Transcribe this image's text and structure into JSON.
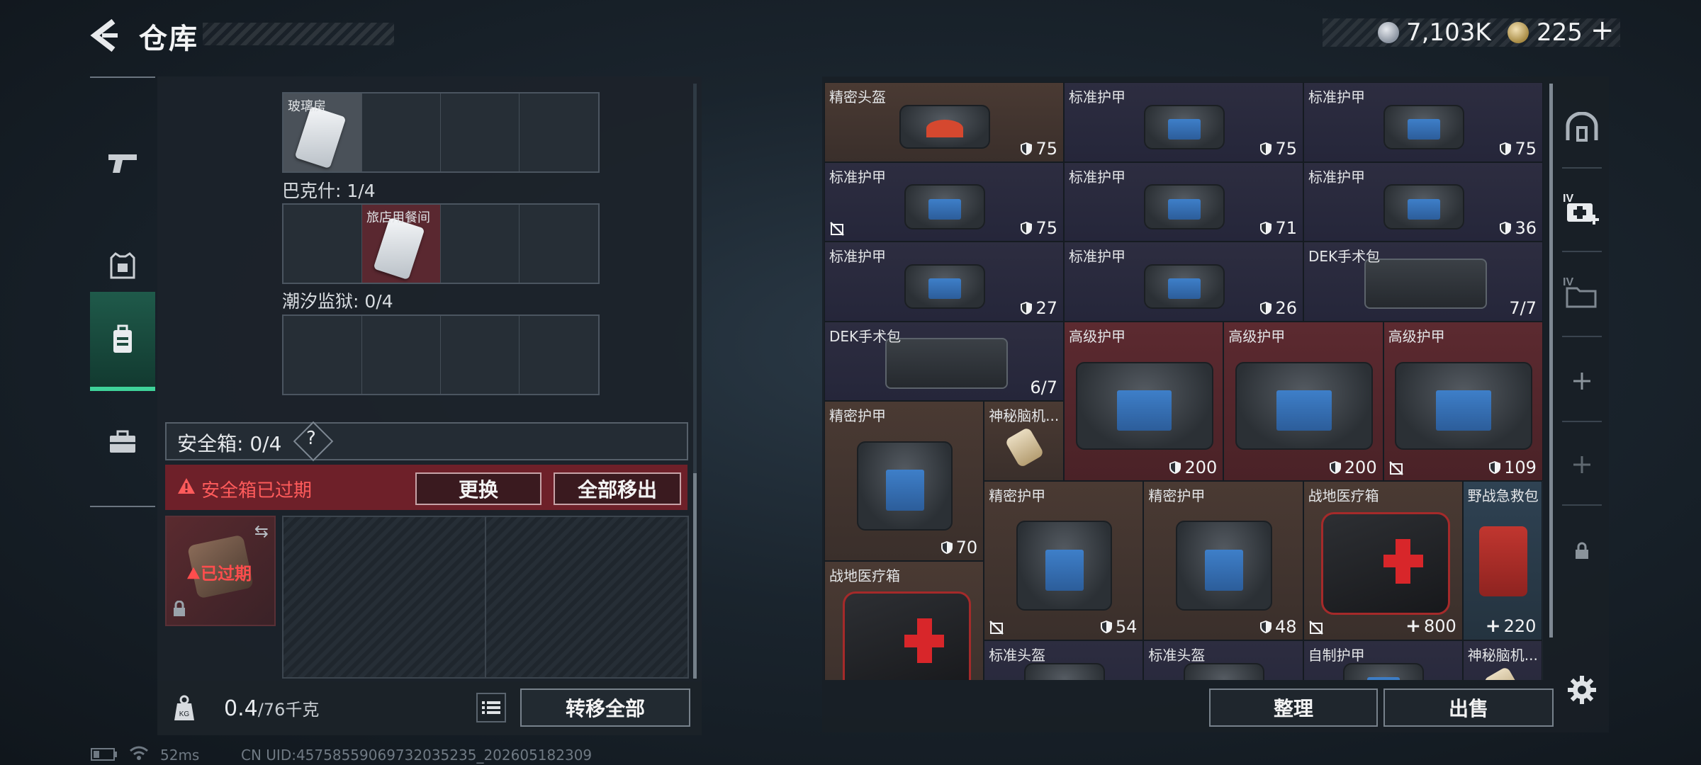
{
  "header": {
    "title": "仓库",
    "currency": [
      {
        "icon": "silver-coin-icon",
        "value": "7,103K"
      },
      {
        "icon": "gold-coin-icon",
        "value": "225"
      }
    ],
    "add_currency_symbol": "+"
  },
  "side_nav": [
    {
      "icon": "pistol-icon",
      "active": false
    },
    {
      "icon": "armor-vest-icon",
      "active": false
    },
    {
      "icon": "backpack-icon",
      "active": true
    },
    {
      "icon": "briefcase-icon",
      "active": false
    }
  ],
  "left_panel": {
    "sections": [
      {
        "title": "",
        "items": [
          {
            "slot": 0,
            "label": "玻璃房",
            "color": "gray"
          }
        ]
      },
      {
        "title": "巴克什: 1/4",
        "items": [
          {
            "slot": 1,
            "label": "旅店用餐间",
            "color": "red"
          }
        ]
      },
      {
        "title": "潮汐监狱: 0/4",
        "items": []
      }
    ],
    "safebox": {
      "label": "安全箱: 0/4",
      "help": "?",
      "expired_message": "安全箱已过期",
      "replace_button": "更换",
      "move_all_button": "全部移出",
      "item_status": "已过期",
      "swap_symbol": "⇆"
    },
    "footer": {
      "weight_current": "0.4",
      "weight_max": "/76千克",
      "weight_badge": "KG",
      "transfer_all_button": "转移全部"
    }
  },
  "status_bar": {
    "ping": "52ms",
    "uid": "CN UID:4575855906973203523​5_202605182309"
  },
  "inventory": [
    {
      "label": "精密头盔",
      "type": "helmet",
      "color": "brown",
      "col": 0,
      "row": 0,
      "w": 1,
      "h": 1,
      "value": "75",
      "val_icon": "shield",
      "broken": false
    },
    {
      "label": "标准护甲",
      "type": "vest",
      "color": "purple",
      "col": 1,
      "row": 0,
      "w": 1,
      "h": 1,
      "value": "75",
      "val_icon": "shield",
      "broken": false
    },
    {
      "label": "标准护甲",
      "type": "vest",
      "color": "purple",
      "col": 2,
      "row": 0,
      "w": 1,
      "h": 1,
      "value": "75",
      "val_icon": "shield",
      "broken": false
    },
    {
      "label": "标准护甲",
      "type": "vest",
      "color": "purple",
      "col": 0,
      "row": 1,
      "w": 1,
      "h": 1,
      "value": "75",
      "val_icon": "shield",
      "broken": true
    },
    {
      "label": "标准护甲",
      "type": "vest",
      "color": "purple",
      "col": 1,
      "row": 1,
      "w": 1,
      "h": 1,
      "value": "71",
      "val_icon": "shield",
      "broken": false
    },
    {
      "label": "标准护甲",
      "type": "vest",
      "color": "purple",
      "col": 2,
      "row": 1,
      "w": 1,
      "h": 1,
      "value": "36",
      "val_icon": "shield",
      "broken": false
    },
    {
      "label": "标准护甲",
      "type": "vest",
      "color": "purple",
      "col": 0,
      "row": 2,
      "w": 1,
      "h": 1,
      "value": "27",
      "val_icon": "shield",
      "broken": false
    },
    {
      "label": "标准护甲",
      "type": "vest",
      "color": "purple",
      "col": 1,
      "row": 2,
      "w": 1,
      "h": 1,
      "value": "26",
      "val_icon": "shield",
      "broken": false
    },
    {
      "label": "DEK手术包",
      "type": "kit",
      "color": "purple",
      "col": 2,
      "row": 2,
      "w": 1,
      "h": 1,
      "value": "7/7",
      "val_icon": "",
      "broken": false
    },
    {
      "label": "DEK手术包",
      "type": "kit",
      "color": "purple",
      "col": 0,
      "row": 3,
      "w": 1,
      "h": 1,
      "value": "6/7",
      "val_icon": "",
      "broken": false
    },
    {
      "label": "高级护甲",
      "type": "bigvest",
      "color": "red",
      "col": 1,
      "row": 3,
      "w": 2,
      "h": 2,
      "value": "200",
      "val_icon": "shield",
      "broken": false
    },
    {
      "label": "高级护甲",
      "type": "bigvest",
      "color": "red",
      "col": 3,
      "row": 3,
      "w": 2,
      "h": 2,
      "value": "200",
      "val_icon": "shield",
      "broken": false
    },
    {
      "label": "高级护甲",
      "type": "bigvest",
      "color": "red",
      "col": 5,
      "row": 3,
      "w": 2,
      "h": 2,
      "value": "109",
      "val_icon": "shield",
      "broken": true
    },
    {
      "label": "精密护甲",
      "type": "vest",
      "color": "brown",
      "col": 0,
      "row": 4,
      "w": 2,
      "h": 2,
      "value": "70",
      "val_icon": "shield",
      "broken": false
    },
    {
      "label": "神秘脑机...",
      "type": "device",
      "color": "brown",
      "col": 2,
      "row": 4,
      "w": 1,
      "h": 1,
      "value": "",
      "val_icon": "",
      "broken": false
    },
    {
      "label": "精密护甲",
      "type": "vest",
      "color": "brown",
      "col": 2,
      "row": 5,
      "w": 2,
      "h": 2,
      "value": "54",
      "val_icon": "shield",
      "broken": true
    },
    {
      "label": "精密护甲",
      "type": "vest",
      "color": "brown",
      "col": 4,
      "row": 5,
      "w": 2,
      "h": 2,
      "value": "48",
      "val_icon": "shield",
      "broken": false
    },
    {
      "label": "战地医疗箱",
      "type": "firstaid",
      "color": "brown",
      "col": 6,
      "row": 5,
      "w": 2,
      "h": 2,
      "value": "800",
      "val_icon": "plus",
      "broken": true
    },
    {
      "label": "野战急救包",
      "type": "redkit",
      "color": "blue",
      "col": 8,
      "row": 5,
      "w": 1,
      "h": 2,
      "value": "220",
      "val_icon": "plus",
      "broken": false
    },
    {
      "label": "战地医疗箱",
      "type": "firstaid",
      "color": "brown",
      "col": 0,
      "row": 6,
      "w": 2,
      "h": 2,
      "value": "",
      "val_icon": "",
      "broken": false
    },
    {
      "label": "标准头盔",
      "type": "helmet-gray",
      "color": "purple",
      "col": 2,
      "row": 7,
      "w": 2,
      "h": 1,
      "value": "",
      "val_icon": "",
      "broken": false
    },
    {
      "label": "标准头盔",
      "type": "helmet-gray",
      "color": "purple",
      "col": 4,
      "row": 7,
      "w": 2,
      "h": 1,
      "value": "",
      "val_icon": "",
      "broken": false
    },
    {
      "label": "自制护甲",
      "type": "vest",
      "color": "purple",
      "col": 6,
      "row": 7,
      "w": 2,
      "h": 1,
      "value": "",
      "val_icon": "",
      "broken": false
    },
    {
      "label": "神秘脑机...",
      "type": "device",
      "color": "purple",
      "col": 8,
      "row": 7,
      "w": 1,
      "h": 1,
      "value": "",
      "val_icon": "",
      "broken": false
    }
  ],
  "right_nav": [
    "helmet-slot-icon",
    "add-medkit-icon",
    "folder-icon",
    "plus-icon",
    "plus-icon",
    "lock-icon"
  ],
  "right_nav_labels": [
    "",
    "IV",
    "IV",
    "",
    "",
    ""
  ],
  "actions": {
    "sort_button": "整理",
    "sell_button": "出售"
  }
}
